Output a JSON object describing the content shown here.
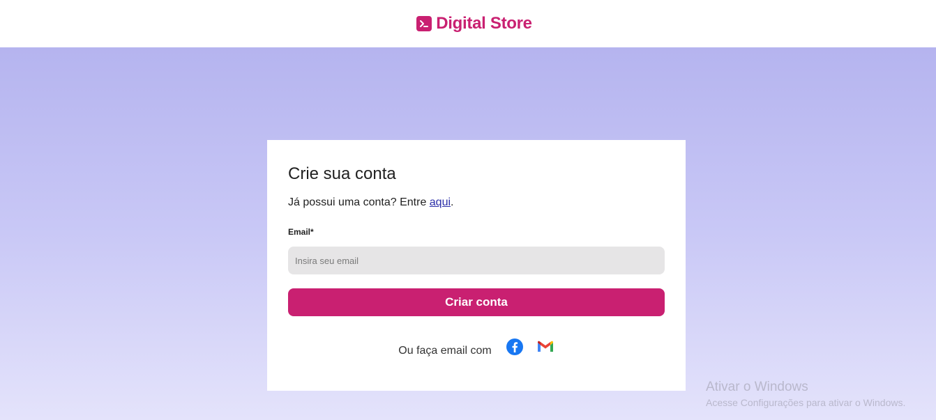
{
  "header": {
    "brand": "Digital Store",
    "brand_color": "#c92071",
    "logo_icon": "terminal-icon"
  },
  "card": {
    "title": "Crie sua conta",
    "subtitle_prefix": "Já possui uma conta? Entre ",
    "login_link": "aqui",
    "subtitle_suffix": ".",
    "email_label": "Email*",
    "email_placeholder": "Insira seu email",
    "email_value": "",
    "submit_label": "Criar conta",
    "social_text": "Ou faça email com",
    "social_icons": [
      "facebook-icon",
      "gmail-icon"
    ]
  },
  "watermark": {
    "title": "Ativar o Windows",
    "subtitle": "Acesse Configurações para ativar o Windows."
  },
  "colors": {
    "accent": "#c92071",
    "background_top": "#b5b4ef",
    "background_bottom": "#e4e3fb",
    "input_bg": "#e6e5e6"
  }
}
